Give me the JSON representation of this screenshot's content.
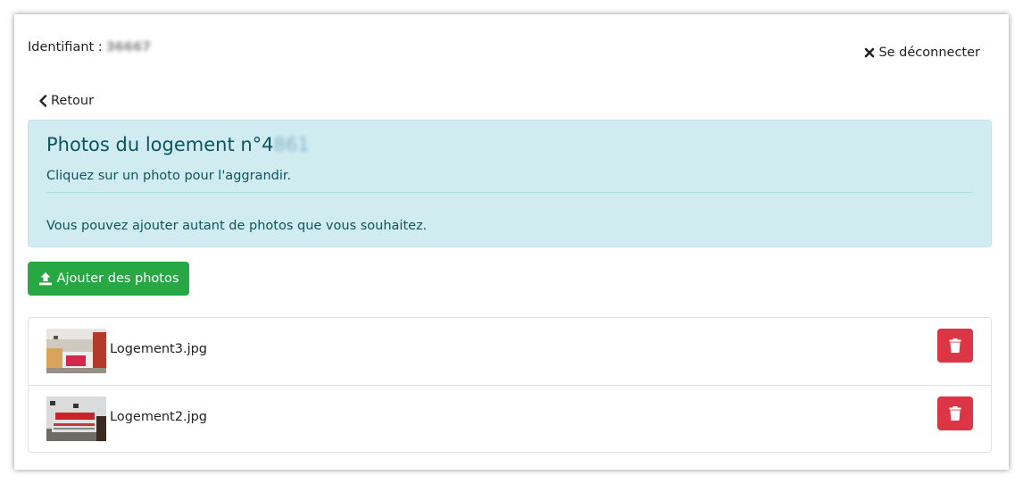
{
  "header": {
    "ident_label": "Identifiant :",
    "ident_value": "36667",
    "logout_label": "Se déconnecter"
  },
  "nav": {
    "back_label": "Retour"
  },
  "alert": {
    "title_prefix": "Photos du logement n°4",
    "title_hidden": "861",
    "line1": "Cliquez sur un photo pour l'aggrandir.",
    "line2": "Vous pouvez ajouter autant de photos que vous souhaitez."
  },
  "actions": {
    "add_label": "Ajouter des photos"
  },
  "photos": [
    {
      "filename": "Logement3.jpg"
    },
    {
      "filename": "Logement2.jpg"
    }
  ],
  "colors": {
    "success": "#28a745",
    "danger": "#dc3545",
    "info_bg": "#d1ecf1",
    "info_text": "#0c5460"
  },
  "icons": {
    "logout": "times-icon",
    "back": "chevron-left-icon",
    "add": "upload-icon",
    "delete": "trash-icon"
  }
}
